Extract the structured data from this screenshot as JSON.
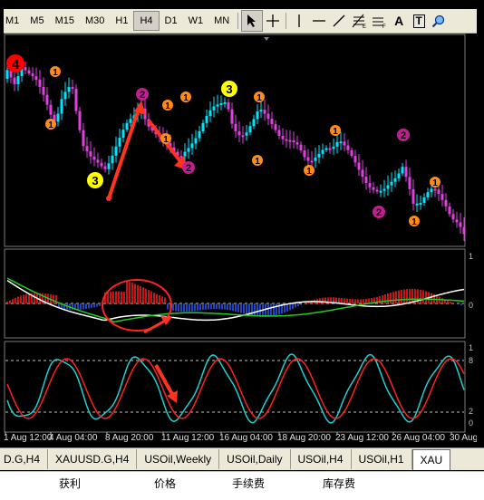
{
  "toolbar": {
    "timeframes": [
      "M1",
      "M5",
      "M15",
      "M30",
      "H1",
      "H4",
      "D1",
      "W1",
      "MN"
    ],
    "active_timeframe": "H4",
    "tools": [
      "cursor-icon",
      "crosshair-icon",
      "vertical-line-icon",
      "horizontal-line-icon",
      "trendline-icon",
      "fibonacci-icon",
      "text-icon",
      "label-icon",
      "zoom-icon"
    ],
    "text_tool_label": "A",
    "label_tool_label": "T"
  },
  "annotations": {
    "wave4": "4",
    "wave3_left": "3",
    "wave3_top": "3",
    "wave2": "2",
    "wave1": "1"
  },
  "axis": {
    "dates": [
      "1 Aug 12:00",
      "4 Aug 04:00",
      "8 Aug 20:00",
      "11 Aug 12:00",
      "16 Aug 04:00",
      "18 Aug 20:00",
      "23 Aug 12:00",
      "26 Aug 04:00",
      "30 Aug"
    ],
    "macd_zero": "0",
    "macd_top": "1",
    "stoch_top": "1",
    "stoch_80": "8",
    "stoch_20": "2",
    "stoch_0": "0"
  },
  "tabs": [
    "D.G,H4",
    "XAUUSD.G,H4",
    "USOil,Weekly",
    "USOil,Daily",
    "USOil,H4",
    "USOil,H1",
    "XAU"
  ],
  "active_tab": "XAU",
  "columns": [
    "获利",
    "价格",
    "手续费",
    "库存费"
  ],
  "colors": {
    "bull": "#00e5ff",
    "bear": "#e040e0",
    "annot_orange": "#ff8c1a",
    "annot_magenta": "#c0208f",
    "annot_yellow": "#ffff00",
    "annot_red": "#ff0000",
    "arrow": "#ff3322"
  }
}
